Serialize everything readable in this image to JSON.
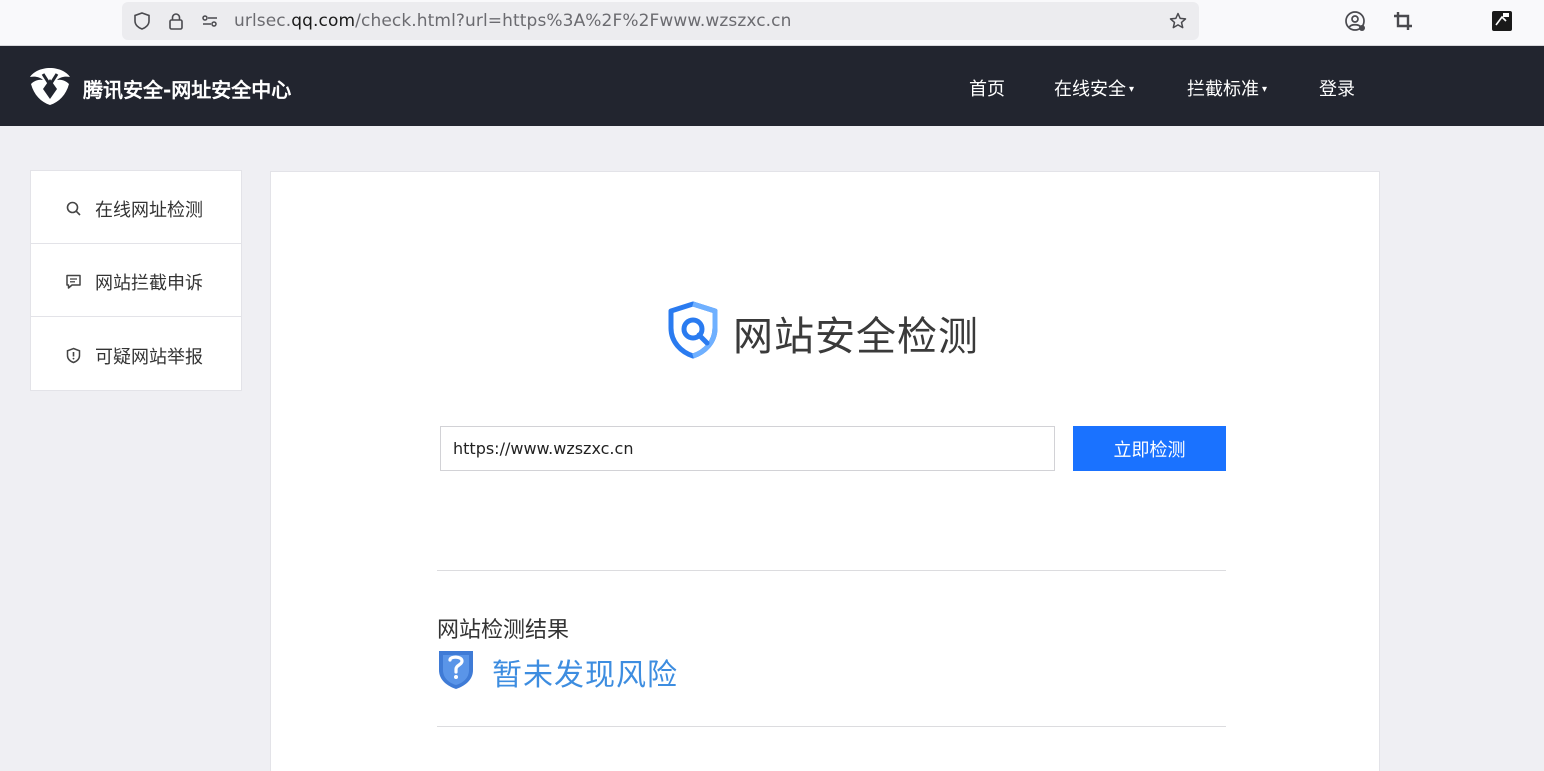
{
  "browser": {
    "url_prefix": "urlsec.",
    "url_domain": "qq.com",
    "url_suffix": "/check.html?url=https%3A%2F%2Fwww.wzszxc.cn",
    "icons": [
      "shield-icon",
      "lock-icon",
      "permissions-icon",
      "star-icon",
      "account-icon",
      "crop-icon",
      "extension-icon"
    ]
  },
  "header": {
    "brand": "腾讯安全-网址安全中心",
    "nav": [
      {
        "label": "首页"
      },
      {
        "label": "在线安全",
        "caret": "▾"
      },
      {
        "label": "拦截标准",
        "caret": "▾"
      },
      {
        "label": "登录"
      }
    ]
  },
  "sidebar": {
    "items": [
      {
        "label": "在线网址检测",
        "icon": "search-icon"
      },
      {
        "label": "网站拦截申诉",
        "icon": "message-icon"
      },
      {
        "label": "可疑网站举报",
        "icon": "shield-alert-icon"
      }
    ]
  },
  "main": {
    "title": "网站安全检测",
    "input_value": "https://www.wzszxc.cn",
    "button_label": "立即检测",
    "result_heading": "网站检测结果",
    "result_text": "暂未发现风险"
  },
  "colors": {
    "header_bg": "#22252f",
    "accent": "#1a72ff",
    "result_text": "#3d8de0",
    "page_bg": "#efeff3"
  }
}
